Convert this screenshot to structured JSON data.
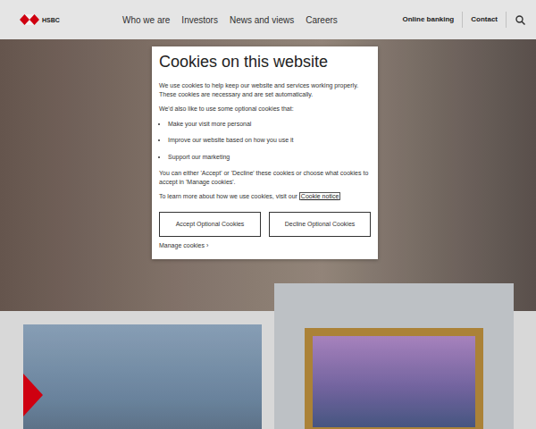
{
  "header": {
    "logo": "HSBC",
    "nav": [
      "Who we are",
      "Investors",
      "News and views",
      "Careers"
    ],
    "utility": [
      "Online banking",
      "Contact"
    ]
  },
  "cookie_dialog": {
    "title": "Cookies on this website",
    "intro": "We use cookies to help keep our website and services working properly. These cookies are necessary and are set automatically.",
    "optional_intro": "We'd also like to use some optional cookies that:",
    "bullets": [
      "Make your visit more personal",
      "Improve our website based on how you use it",
      "Support our marketing"
    ],
    "choice_text": "You can either 'Accept' or 'Decline' these cookies or choose what cookies to accept in 'Manage cookies'.",
    "learn_more": "To learn more about how we use cookies, visit our",
    "cookie_notice_link": "Cookie notice",
    "buttons": [
      "Accept Optional Cookies",
      "Decline Optional Cookies"
    ],
    "manage_link": "Manage cookies ›"
  }
}
